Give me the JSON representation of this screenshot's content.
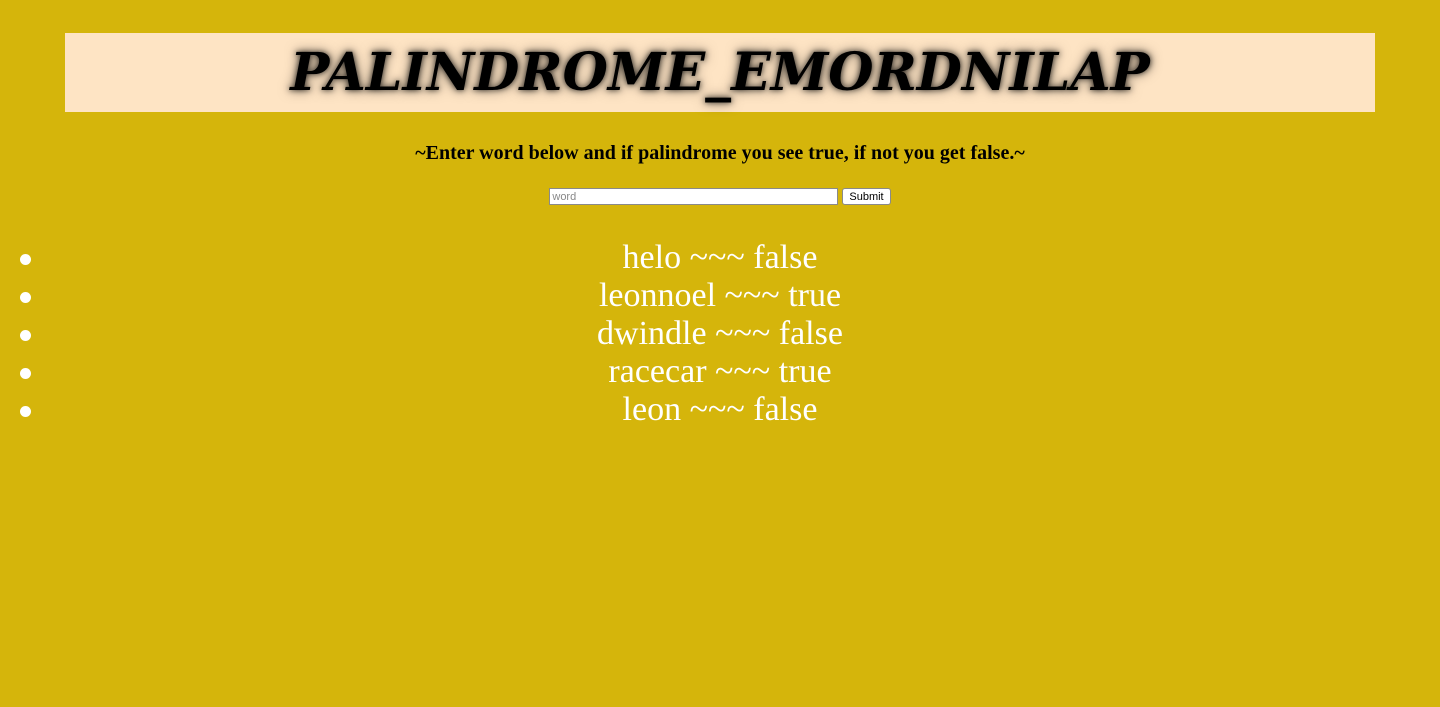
{
  "header": {
    "title": "PALINDROME_EMORDNILAP"
  },
  "instructions": "~Enter word below and if palindrome you see true, if not you get false.~",
  "form": {
    "input_value": "",
    "input_placeholder": "word",
    "submit_label": "Submit"
  },
  "results": [
    {
      "text": "helo ~~~ false"
    },
    {
      "text": "leonnoel ~~~ true"
    },
    {
      "text": "dwindle ~~~ false"
    },
    {
      "text": "racecar ~~~ true"
    },
    {
      "text": "leon ~~~ false"
    }
  ],
  "colors": {
    "background": "#d5b50b",
    "banner": "#fee4c4",
    "list_text": "#ffffff"
  }
}
